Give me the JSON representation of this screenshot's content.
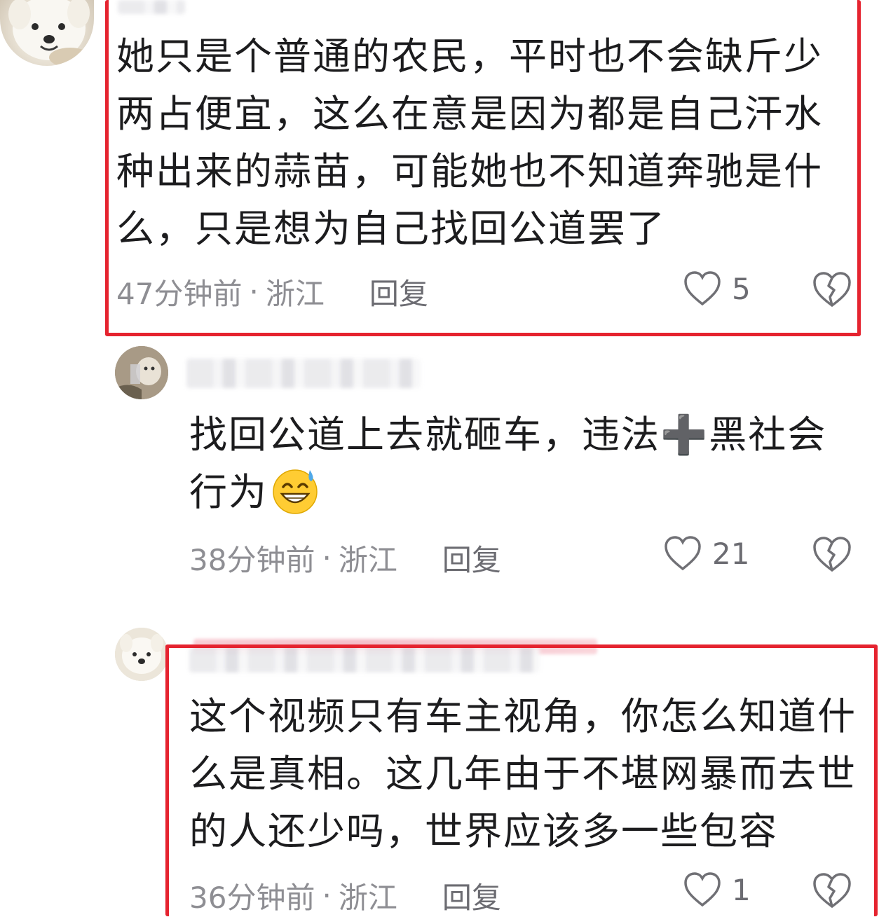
{
  "comments": [
    {
      "text_lines": [
        "她只是个普通的农民，平时也不会缺斤少",
        "两占便宜，这么在意是因为都是自己汗水",
        "种出来的蒜苗，可能她也不知道奔驰是什",
        "么，只是想为自己找回公道罢了"
      ],
      "time": "47分钟前",
      "separator": "·",
      "location": "浙江",
      "reply_label": "回复",
      "likes": "5"
    },
    {
      "text_lines": [
        "找回公道上去就砸车，违法➕黑社会",
        "行为"
      ],
      "time": "38分钟前",
      "separator": "·",
      "location": "浙江",
      "reply_label": "回复",
      "likes": "21"
    },
    {
      "text_lines": [
        "这个视频只有车主视角，你怎么知道什",
        "么是真相。这几年由于不堪网暴而去世",
        "的人还少吗，世界应该多一些包容"
      ],
      "time": "36分钟前",
      "separator": "·",
      "location": "浙江",
      "reply_label": "回复",
      "likes": "1"
    }
  ],
  "colors": {
    "highlight": "#e5232f",
    "meta_text": "#8e8e93",
    "body_text": "#1c1c1e"
  },
  "icons": {
    "like": "heart-outline-icon",
    "dislike": "broken-heart-icon",
    "emoji": "grinning-sweat-emoji"
  }
}
